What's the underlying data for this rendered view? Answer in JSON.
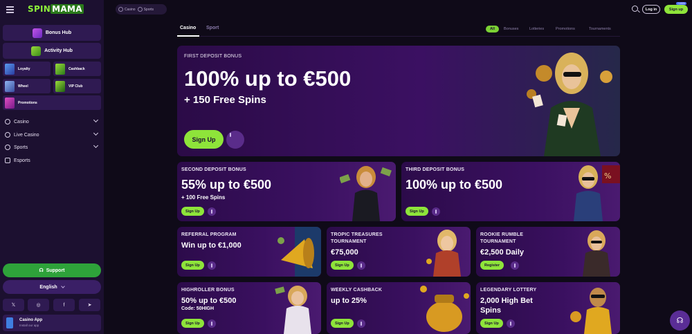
{
  "brand": {
    "logo_part1": "SPIN",
    "logo_part2": "MAMA"
  },
  "sidebar": {
    "hubs": [
      {
        "label": "Bonus Hub"
      },
      {
        "label": "Activity Hub"
      }
    ],
    "tiles": [
      {
        "label": "Loyalty"
      },
      {
        "label": "Cashback"
      },
      {
        "label": "Wheel"
      },
      {
        "label": "VIP Club"
      },
      {
        "label": "Promotions"
      }
    ],
    "nav": [
      {
        "label": "Casino"
      },
      {
        "label": "Live Casino"
      },
      {
        "label": "Sports"
      },
      {
        "label": "Esports"
      }
    ],
    "support": "Support",
    "language": "English",
    "app_title": "Casino App",
    "app_sub": "Install our app"
  },
  "topbar": {
    "pill_casino": "Casino",
    "pill_sports": "Sports",
    "login": "Log in",
    "signup": "Sign up",
    "signup_badge": "+100%"
  },
  "tabs": {
    "casino": "Casino",
    "sport": "Sport"
  },
  "filters": [
    "All",
    "Bonuses",
    "Lotteries",
    "Promotions",
    "Tournaments"
  ],
  "hero": {
    "label": "FIRST DEPOSIT BONUS",
    "title": "100% up to €500",
    "sub": "+ 150 Free Spins",
    "button": "Sign Up"
  },
  "card2": {
    "label": "SECOND DEPOSIT BONUS",
    "title": "55% up to €500",
    "sub": "+ 100 Free Spins",
    "button": "Sign Up"
  },
  "card3": {
    "label": "THIRD DEPOSIT BONUS",
    "title": "100% up to €500",
    "button": "Sign Up"
  },
  "card4": {
    "label": "REFERRAL PROGRAM",
    "title": "Win up to €1,000",
    "button": "Sign Up"
  },
  "card5": {
    "label": "TROPIC TREASURES",
    "label2": "TOURNAMENT",
    "title": "€75,000",
    "button": "Sign Up"
  },
  "card6": {
    "label": "ROOKIE RUMBLE",
    "label2": "TOURNAMENT",
    "title": "€2,500 Daily",
    "button": "Register"
  },
  "card7": {
    "label": "HIGHROLLER BONUS",
    "title": "50% up to €500",
    "sub": "Code: 50HIGH",
    "button": "Sign Up"
  },
  "card8": {
    "label": "WEEKLY CASHBACK",
    "title": "up to 25%",
    "button": "Sign Up"
  },
  "card9": {
    "label": "LEGENDARY LOTTERY",
    "title": "2,000 High Bet",
    "title2": "Spins",
    "button": "Sign Up"
  },
  "colors": {
    "accent_green": "#8ee43a",
    "support_green": "#2ea23a",
    "card_purple": "#3a1060"
  }
}
